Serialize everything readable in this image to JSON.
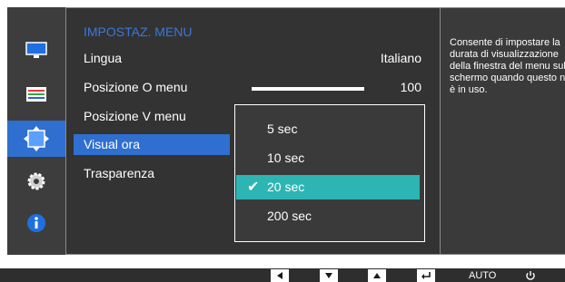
{
  "menu": {
    "title": "IMPOSTAZ. MENU",
    "rows": [
      {
        "label": "Lingua",
        "value": "Italiano"
      },
      {
        "label": "Posizione O menu",
        "value": "100"
      },
      {
        "label": "Posizione V menu"
      },
      {
        "label": "Visual ora"
      },
      {
        "label": "Trasparenza"
      }
    ],
    "slider_level_percent": 100
  },
  "dropdown": {
    "options": [
      "5 sec",
      "10 sec",
      "20 sec",
      "200 sec"
    ],
    "selected": "20 sec"
  },
  "help": {
    "text": "Consente di impostare la durata di visualizzazione della finestra del menu sullo schermo quando questo non è in uso."
  },
  "sidebar": {
    "icons": [
      "monitor-icon",
      "color-bars-icon",
      "move-arrows-icon",
      "gear-icon",
      "info-icon"
    ],
    "active_index": 2
  },
  "bottom_bar": {
    "buttons": [
      "left-arrow-icon",
      "down-arrow-icon",
      "up-arrow-icon",
      "enter-icon"
    ],
    "auto_label": "AUTO",
    "power_icon": "power-icon"
  },
  "colors": {
    "accent_blue": "#2f6fd0",
    "title_blue": "#3a78d8",
    "selection_teal": "#2cb5b3"
  }
}
